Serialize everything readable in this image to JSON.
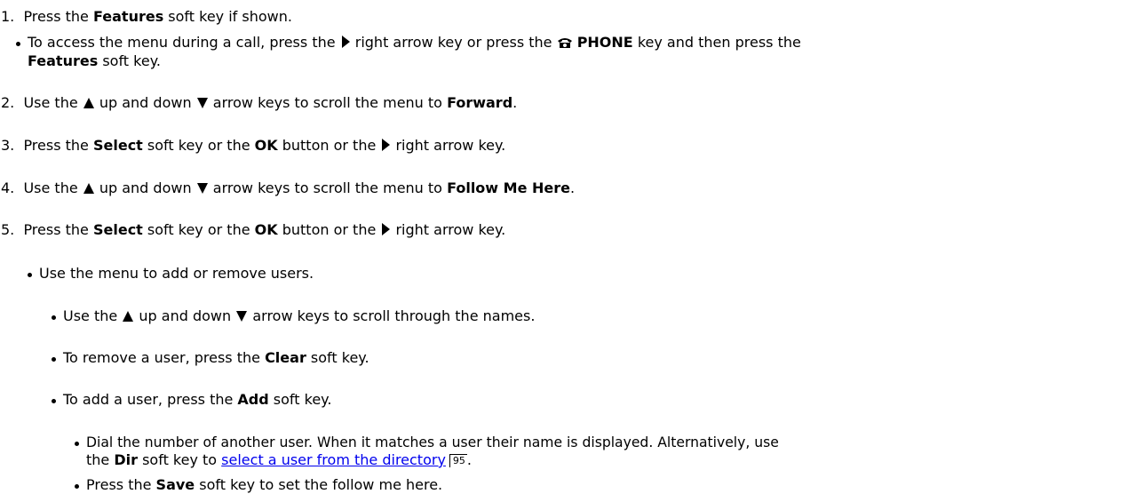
{
  "steps": [
    {
      "num": "1.",
      "t1": "Press the ",
      "b1": "Features",
      "t2": " soft key if shown."
    },
    {
      "num": "2.",
      "t1": "Use the ",
      "icon_up": "up-arrow-icon",
      "t2": " up and down ",
      "icon_down": "down-arrow-icon",
      "t3": " arrow keys to scroll the menu to ",
      "b1": "Forward",
      "t4": "."
    },
    {
      "num": "3.",
      "t1": "Press the ",
      "b1": "Select",
      "t2": " soft key or the ",
      "b2": "OK",
      "t3": " button or the ",
      "icon": "right-arrow-icon",
      "t4": " right arrow key."
    },
    {
      "num": "4.",
      "t1": "Use the ",
      "icon_up": "up-arrow-icon",
      "t2": " up and down ",
      "icon_down": "down-arrow-icon",
      "t3": " arrow keys to scroll the menu to ",
      "b1": "Follow Me Here",
      "t4": "."
    },
    {
      "num": "5.",
      "t1": "Press the ",
      "b1": "Select",
      "t2": " soft key or the ",
      "b2": "OK",
      "t3": " button or the ",
      "icon": "right-arrow-icon",
      "t4": " right arrow key."
    }
  ],
  "sub1": {
    "t1": "To access the menu during a call, press the ",
    "icon_right": "right-arrow-icon",
    "t2": " right arrow key or press the ",
    "icon_phone": "phone-icon",
    "b1": "PHONE",
    "t3": " key and then press the",
    "b2": "Features",
    "t4": " soft key."
  },
  "bullets": {
    "menu": "Use the menu to add or remove users.",
    "scroll": {
      "t1": "Use the ",
      "t2": " up and down ",
      "t3": " arrow keys to scroll through the names."
    },
    "clear": {
      "t1": "To remove a user, press the ",
      "b1": "Clear",
      "t2": " soft key."
    },
    "add": {
      "t1": "To add a user, press the ",
      "b1": "Add",
      "t2": " soft key."
    },
    "dial": {
      "line1": "Dial the number of another user. When it matches a user their name is displayed.  Alternatively, use",
      "t1": "the ",
      "b1": "Dir",
      "t2": " soft key to ",
      "link": "select a user from the directory",
      "ref": "95",
      "t3": "."
    },
    "save": {
      "t1": "Press the ",
      "b1": "Save",
      "t2": " soft key to set the follow me here."
    }
  },
  "colors": {
    "text": "#000000",
    "link": "#0000ee"
  }
}
